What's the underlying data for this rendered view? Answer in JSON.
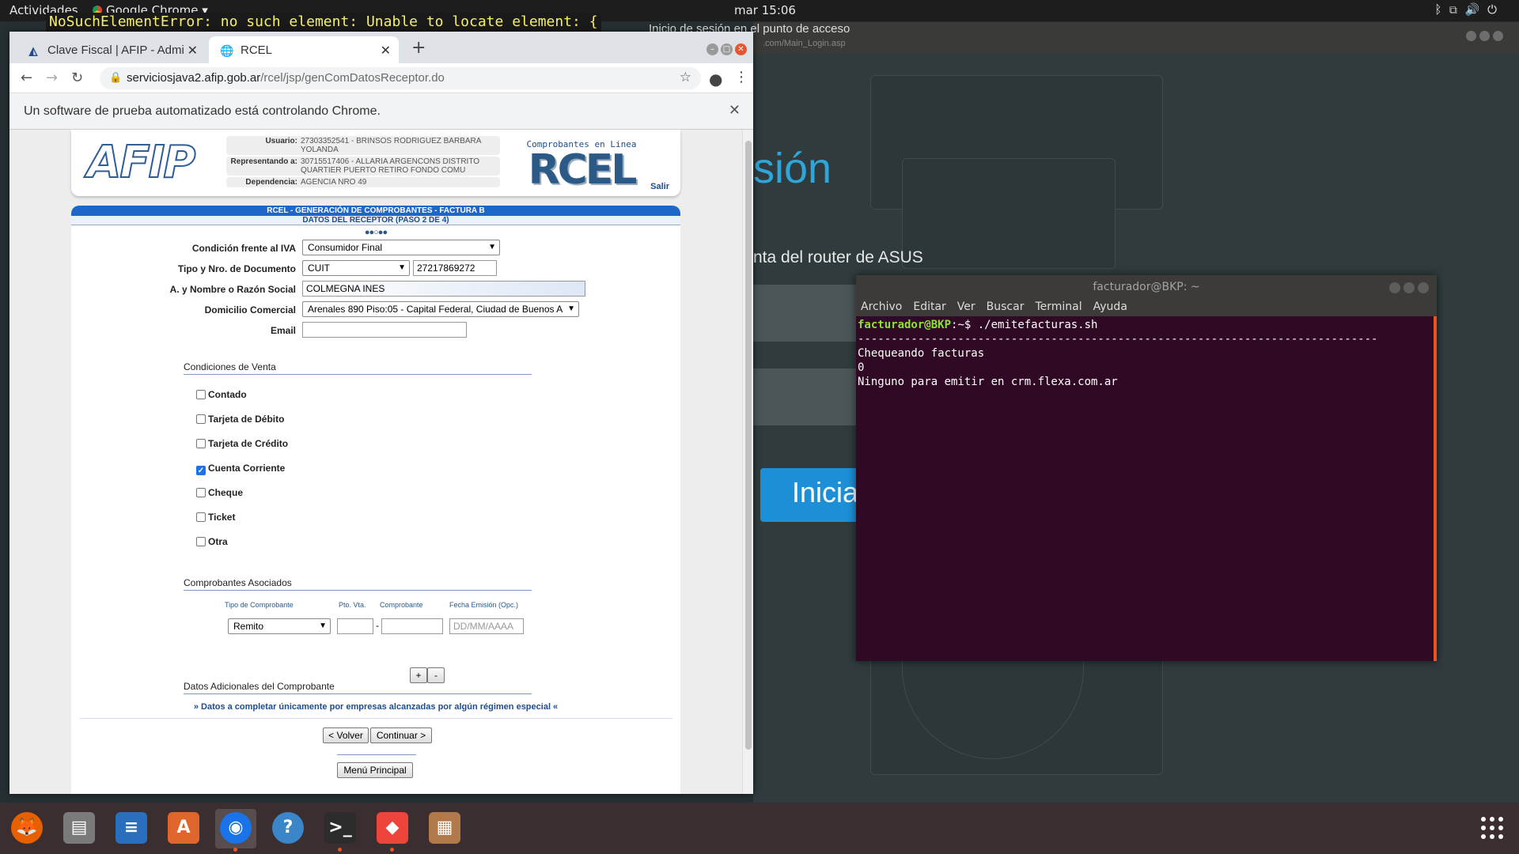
{
  "topbar": {
    "activities": "Actividades",
    "app_name": "Google Chrome ▾",
    "clock": "mar 15:06",
    "tray_icons": [
      "bluetooth-icon",
      "network-icon",
      "volume-icon",
      "power-icon"
    ]
  },
  "error_banner": "NoSuchElementError: no such element: Unable to locate element: {",
  "background_page": {
    "window_title": "Inicio de sesión en el punto de acceso",
    "url_hint": ".com/Main_Login.asp",
    "heading_fragment": "sión",
    "subtitle_fragment": "nta del router de ASUS",
    "button_fragment": "Inicia"
  },
  "chrome": {
    "tabs": [
      {
        "label": "Clave Fiscal | AFIP - Admin",
        "icon": "afip-icon"
      },
      {
        "label": "RCEL",
        "icon": "globe-icon"
      }
    ],
    "url_host": "serviciosjava2.afip.gob.ar",
    "url_path": "/rcel/jsp/genComDatosReceptor.do",
    "infobar": "Un software de prueba automatizado está controlando Chrome."
  },
  "afip": {
    "logo": "AFIP",
    "user": {
      "usuario_label": "Usuario:",
      "usuario": "27303352541 - BRINSOS RODRIGUEZ BARBARA YOLANDA",
      "representando_label": "Representando a:",
      "representando": "30715517406 - ALLARIA ARGENCONS DISTRITO QUARTIER PUERTO RETIRO FONDO COMU",
      "dependencia_label": "Dependencia:",
      "dependencia": "AGENCIA NRO 49"
    },
    "rcel_caption": "Comprobantes en Linea",
    "rcel_logo": "RCEL",
    "salir": "Salir",
    "band_title": "RCEL - GENERACIÓN DE COMPROBANTES - FACTURA B",
    "band_subtitle": "DATOS DEL RECEPTOR (PASO 2 DE 4)",
    "steps": "●●○●●",
    "form": {
      "iva_label": "Condición frente al IVA",
      "iva_value": "Consumidor Final",
      "doc_label": "Tipo y Nro. de Documento",
      "doc_type": "CUIT",
      "doc_number": "27217869272",
      "name_label": "A. y Nombre o Razón Social",
      "name_value": "COLMEGNA INES",
      "domicilio_label": "Domicilio Comercial",
      "domicilio_value": "Arenales 890 Piso:05 - Capital Federal, Ciudad de Buenos A",
      "email_label": "Email",
      "email_value": ""
    },
    "condiciones_title": "Condiciones de Venta",
    "condiciones": [
      {
        "label": "Contado",
        "checked": false
      },
      {
        "label": "Tarjeta de Débito",
        "checked": false
      },
      {
        "label": "Tarjeta de Crédito",
        "checked": false
      },
      {
        "label": "Cuenta Corriente",
        "checked": true
      },
      {
        "label": "Cheque",
        "checked": false
      },
      {
        "label": "Ticket",
        "checked": false
      },
      {
        "label": "Otra",
        "checked": false
      }
    ],
    "asociados_title": "Comprobantes Asociados",
    "asociados_cols": [
      "Tipo de Comprobante",
      "Pto. Vta.",
      "Comprobante",
      "Fecha Emisión (Opc.)"
    ],
    "asociados_tipo": "Remito",
    "asociados_fecha_placeholder": "DD/MM/AAAA",
    "add_btn": "+",
    "remove_btn": "-",
    "adicionales_title": "Datos Adicionales del Comprobante",
    "adicionales_link": "» Datos a completar únicamente por empresas alcanzadas por algún régimen especial «",
    "volver": "< Volver",
    "continuar": "Continuar >",
    "menu_principal": "Menú Principal"
  },
  "terminal": {
    "title": "facturador@BKP: ~",
    "menu": [
      "Archivo",
      "Editar",
      "Ver",
      "Buscar",
      "Terminal",
      "Ayuda"
    ],
    "prompt_user": "facturador@BKP",
    "prompt_path": ":~$",
    "command": " ./emitefacturas.sh",
    "output": "\n------------------------------------------------------------------------------\nChequeando facturas\n0\nNinguno para emitir en crm.flexa.com.ar"
  },
  "dock": {
    "apps": [
      {
        "name": "firefox-icon",
        "glyph": "🦊",
        "color": "#e66000",
        "running": false
      },
      {
        "name": "files-icon",
        "glyph": "▤",
        "color": "#7a7a7a",
        "running": false
      },
      {
        "name": "writer-icon",
        "glyph": "≡",
        "color": "#2a6fbd",
        "running": false
      },
      {
        "name": "software-icon",
        "glyph": "A",
        "color": "#e0672b",
        "running": false
      },
      {
        "name": "chrome-icon",
        "glyph": "◉",
        "color": "#1a73e8",
        "running": true
      },
      {
        "name": "help-icon",
        "glyph": "?",
        "color": "#3a86c8",
        "running": false
      },
      {
        "name": "terminal-icon",
        "glyph": ">_",
        "color": "#2c2c2c",
        "running": true
      },
      {
        "name": "anydesk-icon",
        "glyph": "◆",
        "color": "#ef443b",
        "running": true
      },
      {
        "name": "archive-icon",
        "glyph": "▦",
        "color": "#b27a4a",
        "running": false
      }
    ]
  }
}
